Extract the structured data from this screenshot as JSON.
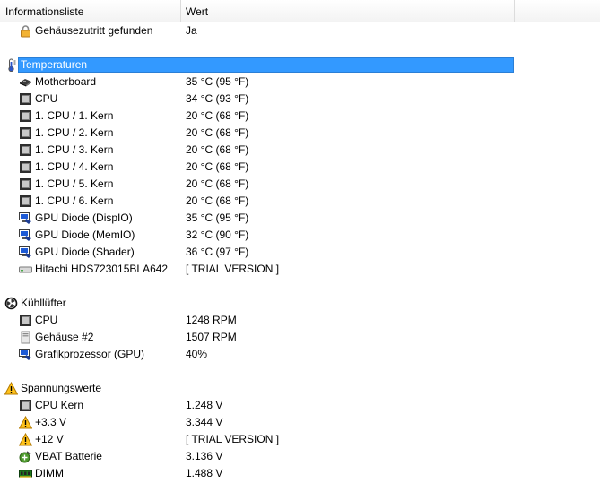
{
  "header": {
    "col1": "Informationsliste",
    "col2": "Wert"
  },
  "rows": [
    {
      "type": "item",
      "indent": 1,
      "icon": "lock-icon",
      "label": "Gehäusezutritt gefunden",
      "value": "Ja"
    },
    {
      "type": "blank"
    },
    {
      "type": "group",
      "icon": "thermometer-icon",
      "label": "Temperaturen",
      "selected": true
    },
    {
      "type": "item",
      "indent": 1,
      "icon": "motherboard-icon",
      "label": "Motherboard",
      "value": "35 °C  (95 °F)"
    },
    {
      "type": "item",
      "indent": 1,
      "icon": "cpu-icon",
      "label": "CPU",
      "value": "34 °C  (93 °F)"
    },
    {
      "type": "item",
      "indent": 1,
      "icon": "cpu-icon",
      "label": "1. CPU / 1. Kern",
      "value": "20 °C  (68 °F)"
    },
    {
      "type": "item",
      "indent": 1,
      "icon": "cpu-icon",
      "label": "1. CPU / 2. Kern",
      "value": "20 °C  (68 °F)"
    },
    {
      "type": "item",
      "indent": 1,
      "icon": "cpu-icon",
      "label": "1. CPU / 3. Kern",
      "value": "20 °C  (68 °F)"
    },
    {
      "type": "item",
      "indent": 1,
      "icon": "cpu-icon",
      "label": "1. CPU / 4. Kern",
      "value": "20 °C  (68 °F)"
    },
    {
      "type": "item",
      "indent": 1,
      "icon": "cpu-icon",
      "label": "1. CPU / 5. Kern",
      "value": "20 °C  (68 °F)"
    },
    {
      "type": "item",
      "indent": 1,
      "icon": "cpu-icon",
      "label": "1. CPU / 6. Kern",
      "value": "20 °C  (68 °F)"
    },
    {
      "type": "item",
      "indent": 1,
      "icon": "gpu-icon",
      "label": "GPU Diode (DispIO)",
      "value": "35 °C  (95 °F)"
    },
    {
      "type": "item",
      "indent": 1,
      "icon": "gpu-icon",
      "label": "GPU Diode (MemIO)",
      "value": "32 °C  (90 °F)"
    },
    {
      "type": "item",
      "indent": 1,
      "icon": "gpu-icon",
      "label": "GPU Diode (Shader)",
      "value": "36 °C  (97 °F)"
    },
    {
      "type": "item",
      "indent": 1,
      "icon": "hdd-icon",
      "label": "Hitachi HDS723015BLA642",
      "value": "[ TRIAL VERSION ]"
    },
    {
      "type": "blank"
    },
    {
      "type": "group",
      "icon": "fan-icon",
      "label": "Kühllüfter",
      "selected": false
    },
    {
      "type": "item",
      "indent": 1,
      "icon": "cpu-icon",
      "label": "CPU",
      "value": "1248 RPM"
    },
    {
      "type": "item",
      "indent": 1,
      "icon": "case-icon",
      "label": "Gehäuse #2",
      "value": "1507 RPM"
    },
    {
      "type": "item",
      "indent": 1,
      "icon": "gpu-icon",
      "label": "Grafikprozessor (GPU)",
      "value": "40%"
    },
    {
      "type": "blank"
    },
    {
      "type": "group",
      "icon": "warning-icon",
      "label": "Spannungswerte",
      "selected": false
    },
    {
      "type": "item",
      "indent": 1,
      "icon": "cpu-icon",
      "label": "CPU Kern",
      "value": "1.248 V"
    },
    {
      "type": "item",
      "indent": 1,
      "icon": "warning-icon",
      "label": "+3.3 V",
      "value": "3.344 V"
    },
    {
      "type": "item",
      "indent": 1,
      "icon": "warning-icon",
      "label": "+12 V",
      "value": "[ TRIAL VERSION ]"
    },
    {
      "type": "item",
      "indent": 1,
      "icon": "battery-icon",
      "label": "VBAT Batterie",
      "value": "3.136 V"
    },
    {
      "type": "item",
      "indent": 1,
      "icon": "memory-icon",
      "label": "DIMM",
      "value": "1.488 V"
    }
  ]
}
